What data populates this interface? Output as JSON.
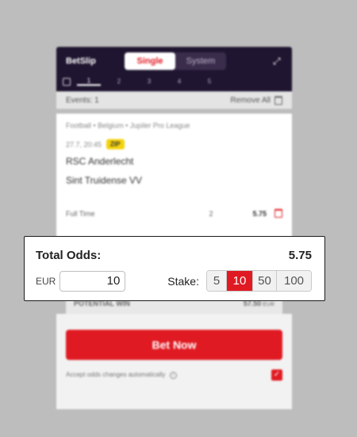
{
  "header": {
    "title": "BetSlip",
    "modes": [
      "Single",
      "System"
    ],
    "active_mode": "Single",
    "numbers": [
      "1",
      "2",
      "3",
      "4",
      "5"
    ]
  },
  "events_bar": {
    "events_label": "Events: 1",
    "remove_all_label": "Remove All"
  },
  "selection": {
    "breadcrumb": "Football • Belgium • Jupiler Pro League",
    "datetime": "27.7, 20:45",
    "badge": "ZIP",
    "home_team": "RSC Anderlecht",
    "away_team": "Sint Truidense VV",
    "market": "Full Time",
    "pick": "2",
    "odds": "5.75"
  },
  "overlay": {
    "total_odds_label": "Total Odds:",
    "total_odds_value": "5.75",
    "currency": "EUR",
    "stake_value": "10",
    "stake_label": "Stake:",
    "chips": [
      "5",
      "10",
      "50",
      "100"
    ],
    "active_chip": "10"
  },
  "potential_win": {
    "label": "POTENTIAL WIN",
    "value": "57.50",
    "currency": "EUR"
  },
  "footer": {
    "bet_button_label": "Bet Now",
    "accept_label": "Accept odds changes automatically",
    "accept_checked": true
  },
  "colors": {
    "accent": "#e01a22",
    "header_bg": "#1f1530",
    "badge": "#f5d20c"
  }
}
